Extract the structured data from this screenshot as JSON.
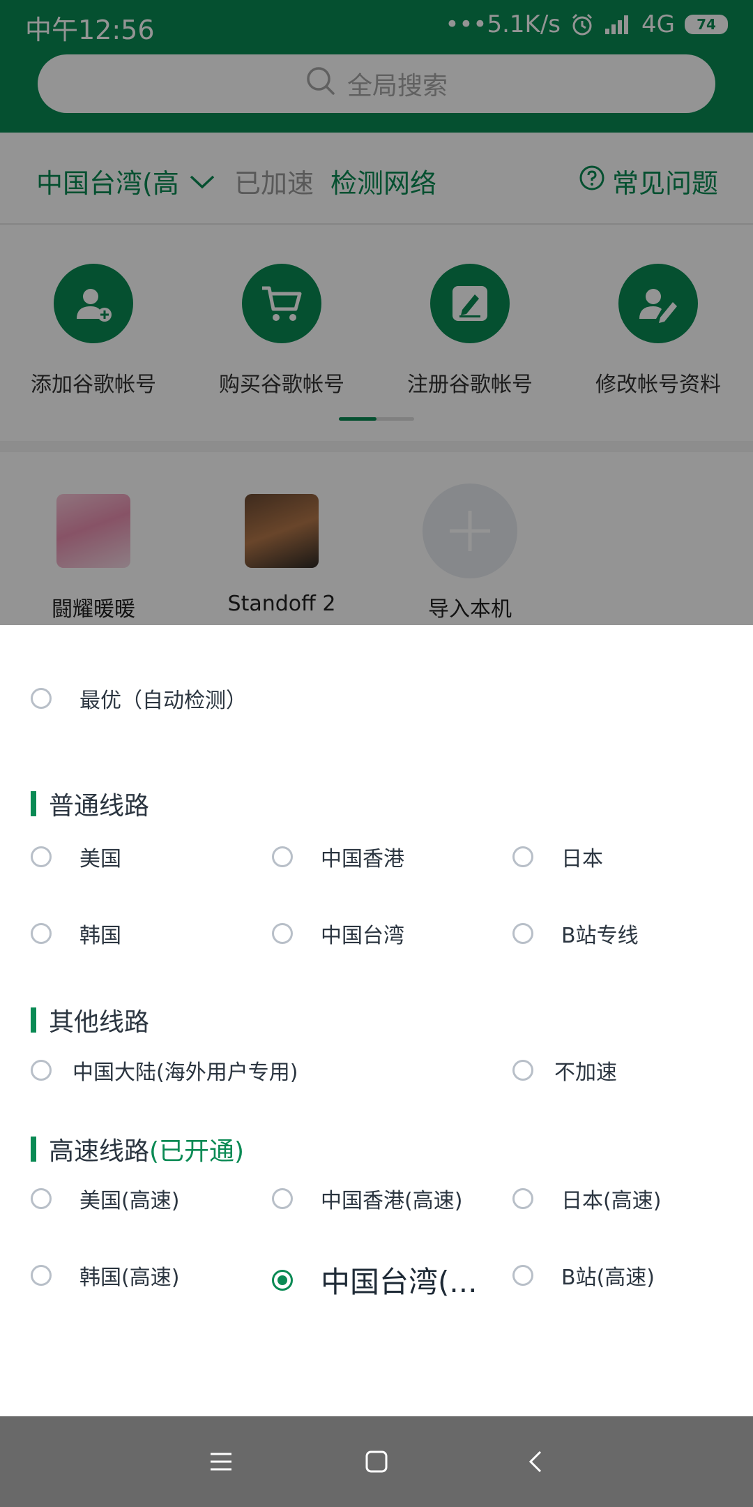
{
  "status_bar": {
    "time": "中午12:56",
    "network_speed": "•••5.1K/s",
    "network_type": "4G",
    "battery": "74"
  },
  "search": {
    "placeholder": "全局搜索"
  },
  "route_bar": {
    "current_route": "中国台湾(高",
    "status": "已加速",
    "check_network": "检测网络",
    "faq": "常见问题"
  },
  "quick_actions": [
    {
      "label": "添加谷歌帐号",
      "icon": "add-user-icon"
    },
    {
      "label": "购买谷歌帐号",
      "icon": "cart-icon"
    },
    {
      "label": "注册谷歌帐号",
      "icon": "edit-icon"
    },
    {
      "label": "修改帐号资料",
      "icon": "user-edit-icon"
    }
  ],
  "games": [
    {
      "name": "闘耀暖暖"
    },
    {
      "name": "Standoff 2"
    },
    {
      "name": "导入本机"
    }
  ],
  "route_sheet": {
    "auto_option": "最优（自动检测）",
    "normal": {
      "title": "普通线路",
      "options": [
        "美国",
        "中国香港",
        "日本",
        "韩国",
        "中国台湾",
        "B站专线"
      ]
    },
    "other": {
      "title": "其他线路",
      "options": [
        "中国大陆(海外用户专用)",
        "不加速"
      ]
    },
    "high_speed": {
      "title": "高速线路",
      "title_note": "(已开通)",
      "options": [
        "美国(高速)",
        "中国香港(高速)",
        "日本(高速)",
        "韩国(高速)",
        "中国台湾(...",
        "B站(高速)"
      ],
      "selected": "中国台湾(..."
    }
  },
  "colors": {
    "accent": "#0a8a54",
    "nav_bar": "#696969"
  }
}
